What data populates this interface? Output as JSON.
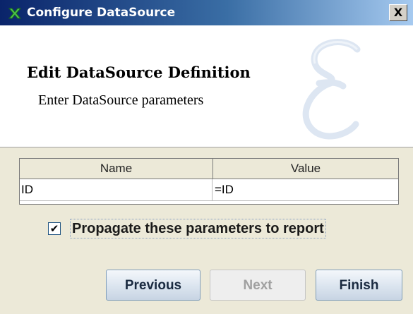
{
  "window": {
    "title": "Configure DataSource",
    "close_label": "X",
    "icon": "datasource-app-icon"
  },
  "header": {
    "title": "Edit DataSource Definition",
    "subtitle": "Enter DataSource parameters",
    "watermark_icon": "script-e-watermark"
  },
  "table": {
    "columns": [
      "Name",
      "Value"
    ],
    "rows": [
      {
        "name": "ID",
        "value": "=ID"
      }
    ]
  },
  "propagate": {
    "checked": true,
    "check_glyph": "✔",
    "label": "Propagate these parameters to report"
  },
  "buttons": {
    "previous": {
      "label": "Previous",
      "enabled": true
    },
    "next": {
      "label": "Next",
      "enabled": false
    },
    "finish": {
      "label": "Finish",
      "enabled": true
    }
  },
  "colors": {
    "titlebar": "#0a246a",
    "window_bg": "#ece9d8",
    "header_bg": "#ffffff",
    "disabled_text": "#a0a0a0"
  }
}
